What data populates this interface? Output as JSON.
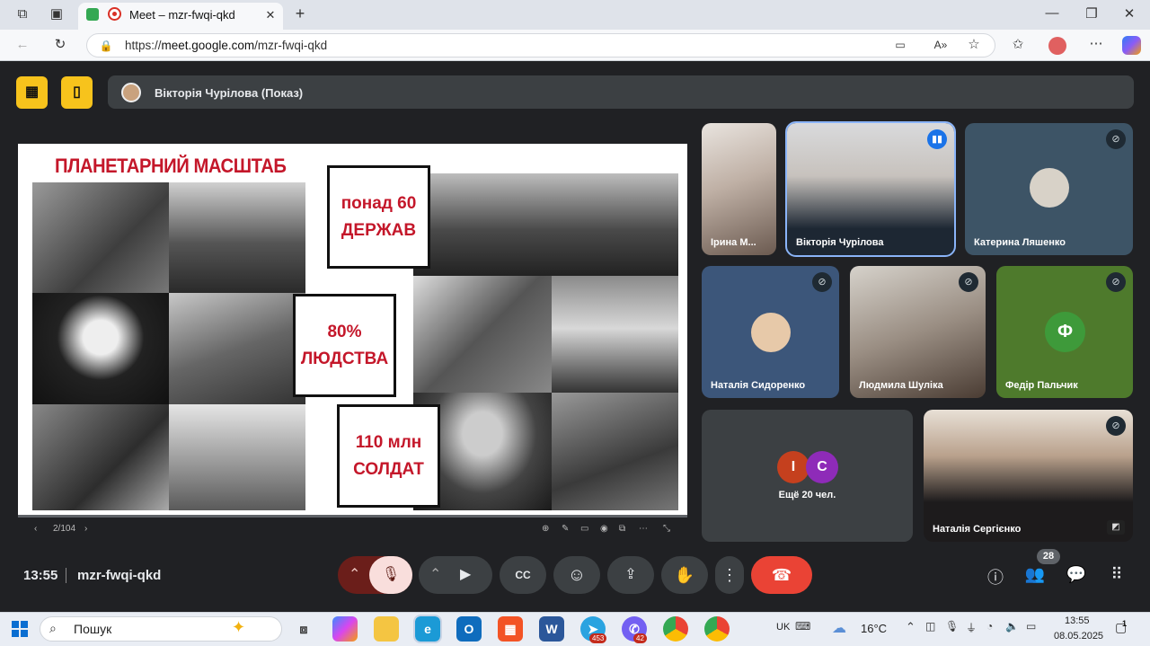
{
  "browser": {
    "tab_title": "Meet – mzr-fwqi-qkd",
    "url_scheme": "https://",
    "url_domain": "meet.google.com",
    "url_path": "/mzr-fwqi-qkd"
  },
  "meet": {
    "presenter_label": "Вікторія Чурілова (Показ)",
    "slide": {
      "title": "ПЛАНЕТАРНИЙ МАСШТАБ",
      "stats": [
        {
          "line1": "понад 60",
          "line2": "ДЕРЖАВ"
        },
        {
          "line1": "80%",
          "line2": "ЛЮДСТВА"
        },
        {
          "line1": "110 млн",
          "line2": "СОЛДАТ"
        }
      ],
      "page": "2/104"
    },
    "participants": [
      {
        "name": "Ірина М..."
      },
      {
        "name": "Вікторія Чурілова"
      },
      {
        "name": "Катерина Ляшенко"
      },
      {
        "name": "Наталія Сидоренко"
      },
      {
        "name": "Людмила Шуліка"
      },
      {
        "name": "Федір Пальчик",
        "initial": "Ф"
      },
      {
        "name": "Наталія Сергієнко"
      }
    ],
    "more": {
      "label": "Ещё 20 чел.",
      "initial1": "І",
      "initial2": "С"
    },
    "time": "13:55",
    "code": "mzr-fwqi-qkd",
    "people_count": "28"
  },
  "taskbar": {
    "search": "Пошук",
    "lang": "UK",
    "temp": "16°C",
    "time": "13:55",
    "date": "08.05.2025",
    "badge_telegram": "453",
    "badge_viber": "42",
    "notif": "1"
  }
}
